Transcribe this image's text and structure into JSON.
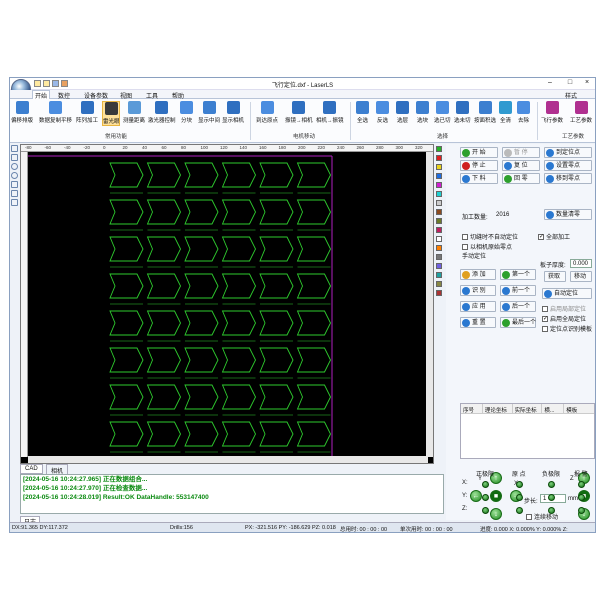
{
  "window": {
    "title": "飞行定位.dxf - LaserLS",
    "style_label": "样式"
  },
  "ribbon_tabs": [
    "开始",
    "数控",
    "设备参数",
    "视图",
    "工具",
    "帮助"
  ],
  "ribbon": {
    "buttons": [
      "偏移排版",
      "数据复制平移",
      "阵列加工",
      "雷光眼",
      "测量距离",
      "激光器控制",
      "分块",
      "显示中间",
      "显示相机",
      "到达原点",
      "振镜→相机",
      "相机→振镜",
      "全选",
      "反选",
      "选层",
      "选块",
      "选已切",
      "选未切",
      "按面积选",
      "全清",
      "去除",
      "飞行参数",
      "工艺参数"
    ],
    "groups": [
      "常用功能",
      "电机移动",
      "选择",
      "工艺参数"
    ]
  },
  "ruler_ticks": [
    "-80",
    "-60",
    "-40",
    "-20",
    "0",
    "20",
    "40",
    "60",
    "80",
    "100",
    "120",
    "140",
    "160",
    "180",
    "200",
    "220",
    "240",
    "260",
    "280",
    "300",
    "320"
  ],
  "palette": [
    "#27b327",
    "#e01f1f",
    "#e8d21a",
    "#1f6de0",
    "#d01fd0",
    "#1fd0d0",
    "#cccccc",
    "#8b4a1f",
    "#6b7c2a",
    "#c02060",
    "#ffffff",
    "#ff7f00",
    "#777777",
    "#7060e0",
    "#20a0a0",
    "#888844",
    "#aa3333"
  ],
  "bottom_tabs": [
    "CAD",
    "相机"
  ],
  "log": {
    "lines": [
      "[2024-05-16 10:24:27.965] 正在数据组合...",
      "[2024-05-16 10:24:27.970] 正在检查数据...",
      "[2024-05-16 10:24:28.019] Result:OK  DataHandle: 553147400"
    ],
    "tab": "日志"
  },
  "status": {
    "coords": "DX:91.365 DY:117.372",
    "drills": "Drills:156",
    "pos": "PX: -321.516  PY: -186.629  PZ: 0.018",
    "total": "总用时: 00 : 00 : 00",
    "single": "单次用时: 00 : 00 : 00",
    "progress": "进度: 0.000 X: 0.000% Y: 0.000% Z:"
  },
  "panel": {
    "buttons": [
      "开 始",
      "暂 停",
      "到定位点",
      "停 止",
      "复 位",
      "设置零点",
      "下 料",
      "回 零",
      "移到零点"
    ],
    "count_label": "加工数量:",
    "count_value": "2016",
    "reset_count": "数量清零",
    "options": [
      "切缝时不自动定位",
      "全部加工",
      "以相机原始零点"
    ],
    "option_checked": [
      false,
      true,
      false
    ],
    "manual_locate": "手动定位",
    "board_thickness_label": "板子厚度:",
    "board_thickness_value": "0.000",
    "get_label": "获取",
    "move_label": "移动",
    "manual_buttons": [
      "添 加",
      "第一个",
      "识 别",
      "前一个",
      "应 用",
      "后一个",
      "重 置",
      "最后一个"
    ],
    "auto_locate": "自动定位",
    "auto_options": [
      "启用局部定位",
      "启用全局定位",
      "定位点识别模板"
    ],
    "auto_checked": [
      false,
      true,
      false
    ],
    "table_headers": [
      "序号",
      "理论坐标",
      "实际坐标",
      "横...",
      "模板"
    ],
    "jog": {
      "y": "Y",
      "x": "X",
      "z": "Z",
      "step_label": "步长:",
      "step_value": "1",
      "unit": "mm",
      "continuous": "连续移动"
    },
    "limits": {
      "headers": [
        "正极限",
        "原 点",
        "负极限",
        "报 警"
      ],
      "axes": [
        "X:",
        "Y:",
        "Z:"
      ]
    }
  }
}
